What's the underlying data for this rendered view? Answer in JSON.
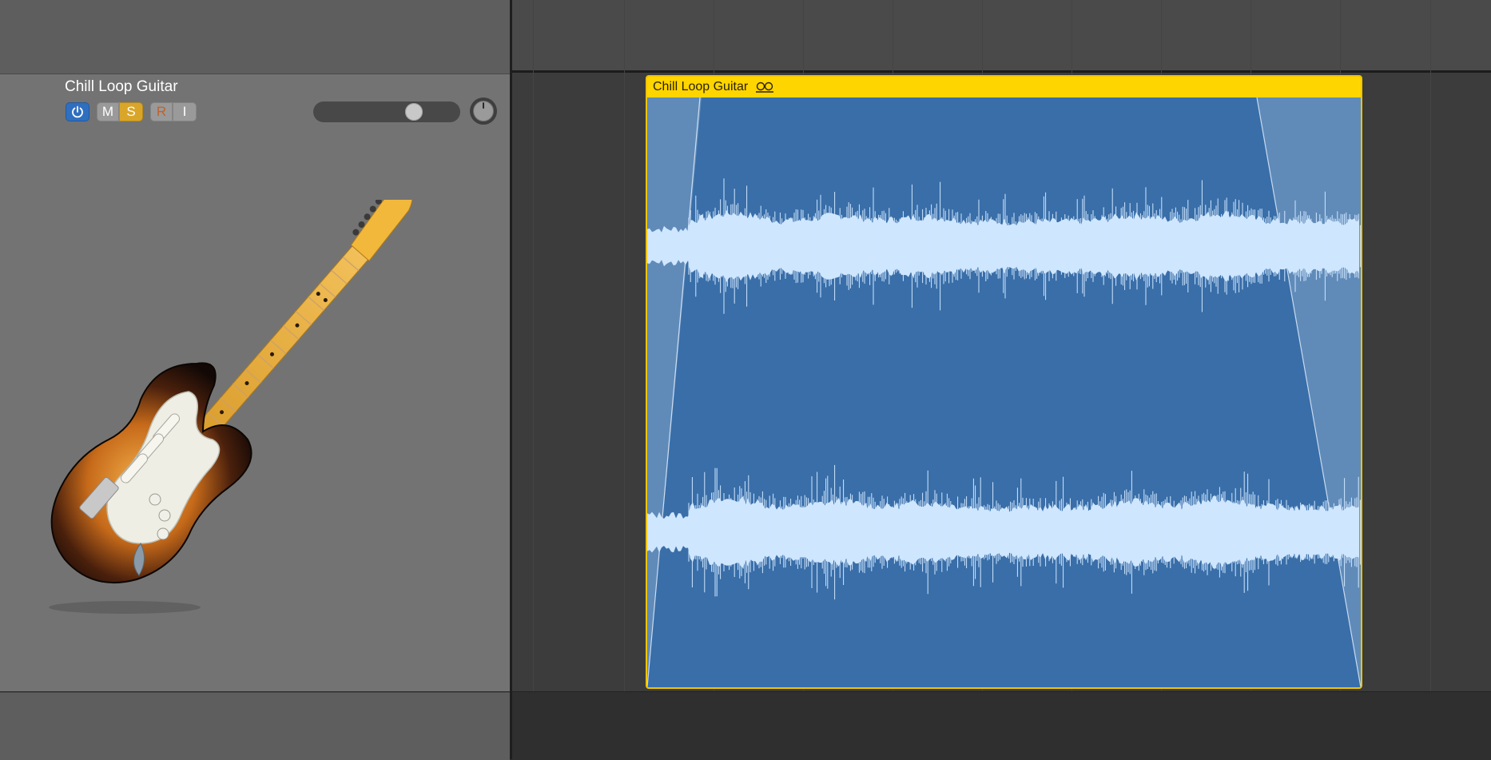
{
  "track": {
    "name": "Chill Loop Guitar",
    "buttons": {
      "mute": "M",
      "solo": "S",
      "record": "R",
      "input": "I"
    },
    "volume_level": 0.72,
    "icon": "electric-guitar-icon"
  },
  "region": {
    "title": "Chill Loop Guitar",
    "loop_icon": "loop-icon",
    "color": "#396ea8",
    "header_color": "#ffd500"
  },
  "colors": {
    "accent_blue": "#2f6fc0",
    "solo_yellow": "#d9a62a",
    "waveform": "#cfe6ff"
  }
}
